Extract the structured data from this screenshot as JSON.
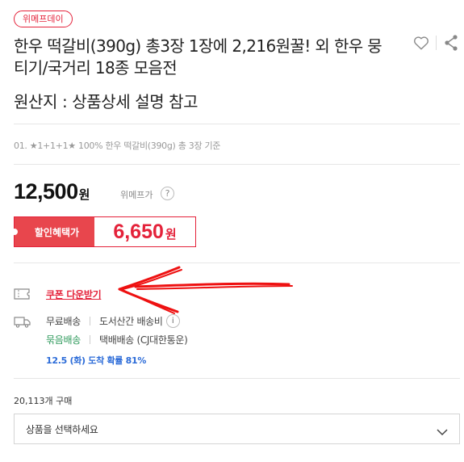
{
  "product": {
    "badge": "위메프데이",
    "title": "한우 떡갈비(390g) 총3장 1장에 2,216원꿀! 외 한우 뭉티기/국거리 18종 모음전",
    "origin": "원산지 : 상품상세 설명 참고",
    "option_line": "01. ★1+1+1★ 100% 한우 떡갈비(390g) 총 3장 기준"
  },
  "price": {
    "amount": "12,500",
    "unit": "원",
    "label": "위메프가",
    "help": "?"
  },
  "discount": {
    "label": "할인혜택가",
    "amount": "6,650",
    "unit": "원"
  },
  "coupon": {
    "label": "쿠폰 다운받기"
  },
  "shipping": {
    "free_label": "무료배송",
    "mountain_label": "도서산간 배송비",
    "bundle_label": "묶음배송",
    "carrier": "택배배송 (CJ대한통운)",
    "info": "i",
    "arrival": "12.5 (화) 도착 확률 81%"
  },
  "purchase_count": "20,113개 구매",
  "select": {
    "placeholder": "상품을 선택하세요"
  },
  "icons": {
    "heart": "heart-icon",
    "share": "share-icon",
    "coupon": "coupon-icon",
    "truck": "truck-icon",
    "chevron": "chevron-down-icon"
  },
  "colors": {
    "accent": "#e4223a",
    "discount_bg": "#e8464d",
    "bundle": "#2f9a5c",
    "arrival": "#2b6bd8",
    "annotation_arrow": "#ee1111"
  }
}
